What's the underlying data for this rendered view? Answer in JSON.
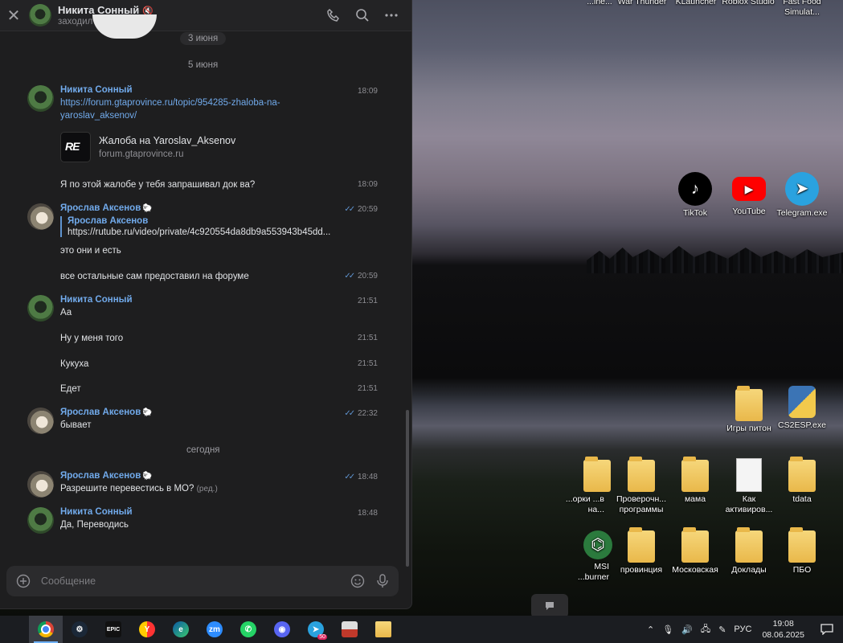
{
  "chat": {
    "header": {
      "name": "Никита Сонный",
      "status": "заходил недавно"
    },
    "dates": {
      "top": "3 июня",
      "d1": "5 июня",
      "d2": "сегодня"
    },
    "messages": {
      "m1": {
        "author": "Никита Сонный",
        "time": "18:09",
        "link": "https://forum.gtaprovince.ru/topic/954285-zhaloba-na-yaroslav_aksenov/",
        "link_line1": "https://forum.gtaprovince.ru/topic/954285-zhaloba-na-",
        "link_line2": "yaroslav_aksenov/",
        "preview_title": "Жалоба на Yaroslav_Aksenov",
        "preview_site": "forum.gtaprovince.ru"
      },
      "m2": {
        "text": "Я по этой жалобе у тебя запрашивал док ва?",
        "time": "18:09"
      },
      "m3": {
        "author": "Ярослав Аксенов",
        "time": "20:59",
        "reply_author": "Ярослав Аксенов",
        "reply_text": "https://rutube.ru/video/private/4c920554da8db9a553943b45dd...",
        "text": "это они и есть"
      },
      "m4": {
        "text": "все остальные сам предоставил на форуме",
        "time": "20:59"
      },
      "m5": {
        "author": "Никита Сонный",
        "time": "21:51",
        "text": "Аа"
      },
      "m6": {
        "text": "Ну у меня того",
        "time": "21:51"
      },
      "m7": {
        "text": "Кукуха",
        "time": "21:51"
      },
      "m8": {
        "text": "Едет",
        "time": "21:51"
      },
      "m9": {
        "author": "Ярослав Аксенов",
        "time": "22:32",
        "text": "бывает"
      },
      "m10": {
        "author": "Ярослав Аксенов",
        "time": "18:48",
        "text": "Разрешите перевестись в МО?",
        "edited": "(ред.)"
      },
      "m11": {
        "author": "Никита Сонный",
        "time": "18:48",
        "text": "Да, Переводись"
      }
    },
    "composer": {
      "placeholder": "Сообщение"
    }
  },
  "desktop": {
    "top_labels": [
      "...ine...",
      "War Thunder",
      "KLauncher",
      "Roblox Studio",
      "Fast Food Simulat..."
    ],
    "icons": {
      "tiktok": "TikTok",
      "youtube": "YouTube",
      "telegram": "Telegram.exe",
      "igry": "Игры питон",
      "cs2esp": "CS2ESP.exe",
      "sborki": "...орки ...в на...",
      "proverochn": "Проверочн... программы",
      "mama": "мама",
      "kak": "Как активиров...",
      "tdata": "tdata",
      "msi": "MSI ...burner",
      "provincia": "провинция",
      "moskovskaya": "Московская",
      "doklady": "Доклады",
      "pbo": "ПБО"
    }
  },
  "taskbar": {
    "apps": [
      "chrome",
      "steam",
      "epic-games",
      "yandex",
      "edge",
      "zoom",
      "whatsapp",
      "discord",
      "telegram",
      "app",
      "explorer"
    ],
    "telegram_badge": "50",
    "tray": {
      "lang": "РУС",
      "time": "19:08",
      "date": "08.06.2025"
    }
  }
}
